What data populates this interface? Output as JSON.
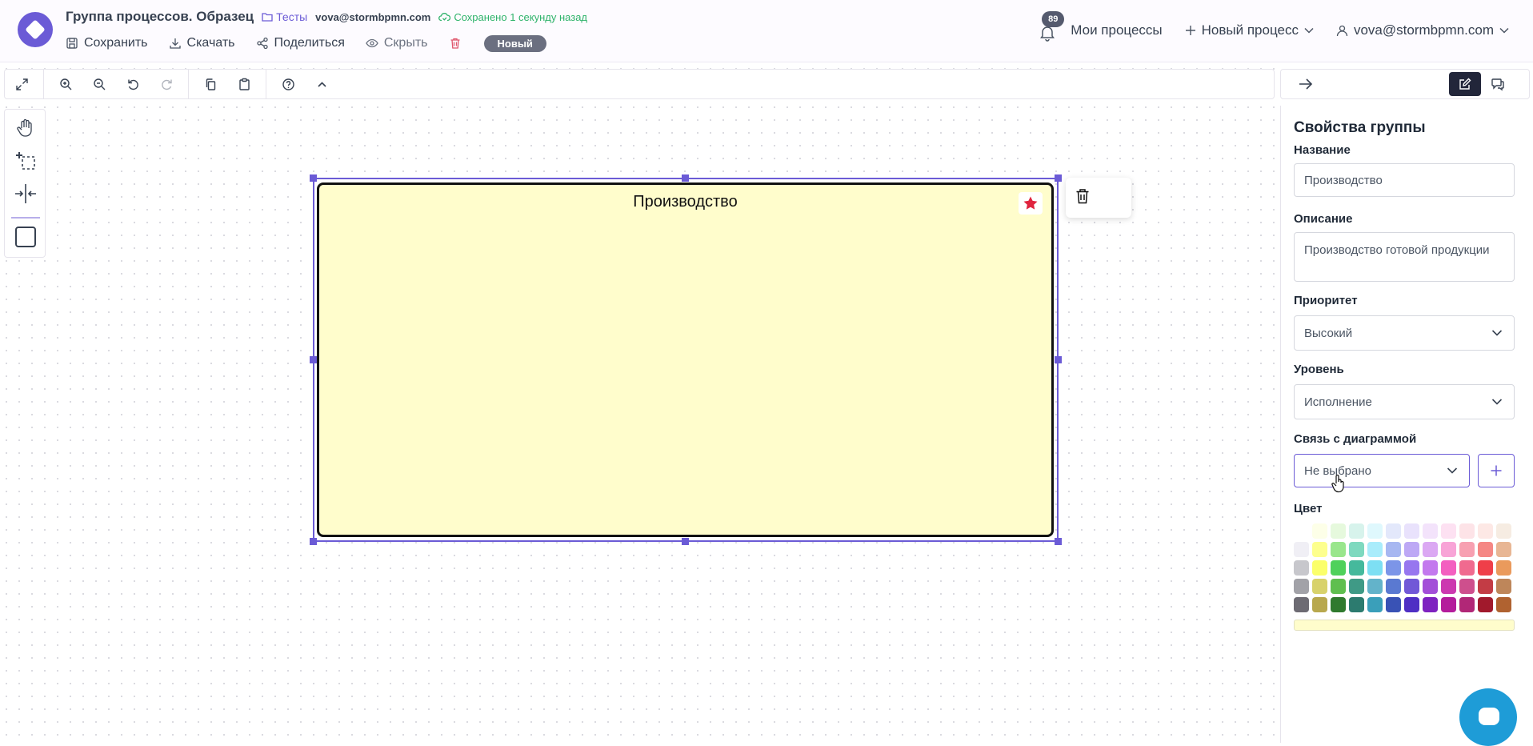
{
  "header": {
    "doc_title": "Группа процессов. Образец",
    "folder": "Тесты",
    "user_short": "vova@stormbpmn.com",
    "saved_status": "Сохранено 1 секунду назад",
    "actions": {
      "save": "Сохранить",
      "download": "Скачать",
      "share": "Поделиться",
      "hide": "Скрыть"
    },
    "status_badge": "Новый",
    "notifications_count": "89",
    "my_processes": "Мои процессы",
    "new_process": "Новый процесс",
    "user_menu": "vova@stormbpmn.com"
  },
  "canvas": {
    "group_title": "Производство",
    "group_fill": "#fffdcc"
  },
  "panel": {
    "title": "Свойства группы",
    "name_label": "Название",
    "name_value": "Производство",
    "description_label": "Описание",
    "description_value": "Производство готовой продукции",
    "priority_label": "Приоритет",
    "priority_value": "Высокий",
    "level_label": "Уровень",
    "level_value": "Исполнение",
    "diagram_link_label": "Связь с диаграммой",
    "diagram_link_value": "Не выбрано",
    "color_label": "Цвет",
    "selected_color": "#fffdcc",
    "palette": [
      [
        "#ffffff",
        "#fdffe8",
        "#e6f9dd",
        "#d7f3ec",
        "#dff8fd",
        "#e3e8fb",
        "#e9e2fc",
        "#f3e3fb",
        "#fde1f2",
        "#fde3e7",
        "#fde8e5",
        "#f6ece2"
      ],
      [
        "#f0eff5",
        "#fdff8e",
        "#99e68c",
        "#7ed9bf",
        "#a9ecfb",
        "#a7b7f1",
        "#bda8f5",
        "#dba8f3",
        "#f8a4d7",
        "#f7a0b1",
        "#f58784",
        "#e8b694"
      ],
      [
        "#c7c7cc",
        "#fbff6a",
        "#4fd15b",
        "#45b99c",
        "#7ddff3",
        "#7c95e8",
        "#9776ef",
        "#c379ee",
        "#f35fc0",
        "#f06a8f",
        "#ef3f49",
        "#ea9a5c"
      ],
      [
        "#a2a2a8",
        "#d8d26b",
        "#5fbf4f",
        "#3f9a86",
        "#63b3ca",
        "#5a79d1",
        "#7158d7",
        "#a34ed8",
        "#cc39b0",
        "#ce4f8d",
        "#c33c45",
        "#be865a"
      ],
      [
        "#6d6b73",
        "#b8a84d",
        "#2f7a2e",
        "#2c7b6f",
        "#3a9fba",
        "#3952b5",
        "#4f2fc4",
        "#7e22c0",
        "#b41c9c",
        "#b12777",
        "#a1192c",
        "#b06230"
      ]
    ]
  }
}
